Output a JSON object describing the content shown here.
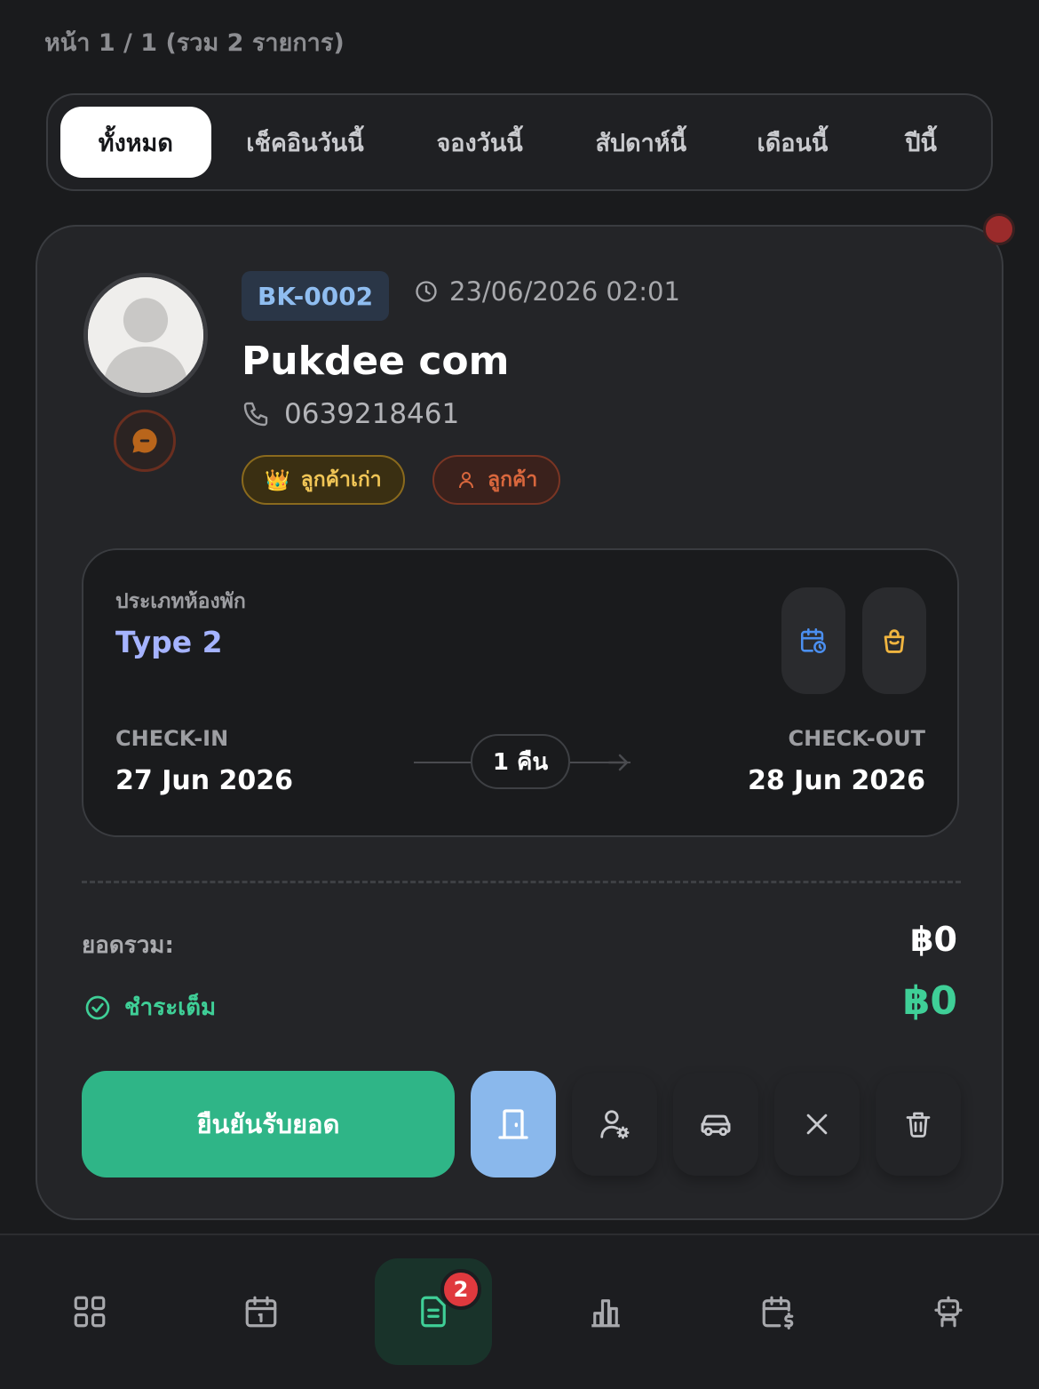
{
  "page_info": "หน้า 1 / 1 (รวม 2 รายการ)",
  "filters": [
    {
      "label": "ทั้งหมด",
      "active": true
    },
    {
      "label": "เช็คอินวันนี้",
      "active": false
    },
    {
      "label": "จองวันนี้",
      "active": false
    },
    {
      "label": "สัปดาห์นี้",
      "active": false
    },
    {
      "label": "เดือนนี้",
      "active": false
    },
    {
      "label": "ปีนี้",
      "active": false
    }
  ],
  "booking": {
    "id": "BK-0002",
    "datetime": "23/06/2026 02:01",
    "guest_name": "Pukdee com",
    "phone": "0639218461",
    "badges": {
      "returning": {
        "icon": "👑",
        "label": "ลูกค้าเก่า"
      },
      "customer": {
        "label": "ลูกค้า"
      }
    },
    "room": {
      "label": "ประเภทห้องพัก",
      "type": "Type 2"
    },
    "check_in": {
      "label": "CHECK-IN",
      "date": "27 Jun 2026"
    },
    "check_out": {
      "label": "CHECK-OUT",
      "date": "28 Jun 2026"
    },
    "nights": "1 คืน",
    "total_label": "ยอดรวม:",
    "total_value": "฿0",
    "paid_label": "ชำระเต็ม",
    "paid_value": "฿0",
    "confirm_label": "ยืนยันรับยอด"
  },
  "nav": {
    "badge_count": "2",
    "items": [
      "dashboard-icon",
      "calendar-icon",
      "bookings-icon",
      "reports-icon",
      "calendar-price-icon",
      "robot-icon"
    ]
  },
  "colors": {
    "accent_green": "#2fb587",
    "paid_green": "#3fcf97",
    "room_type": "#a5b3ff",
    "booking_id": "#8fbdf0",
    "badge_gold": "#f0c556",
    "badge_orange": "#d9673d",
    "nav_badge": "#e0393e"
  }
}
